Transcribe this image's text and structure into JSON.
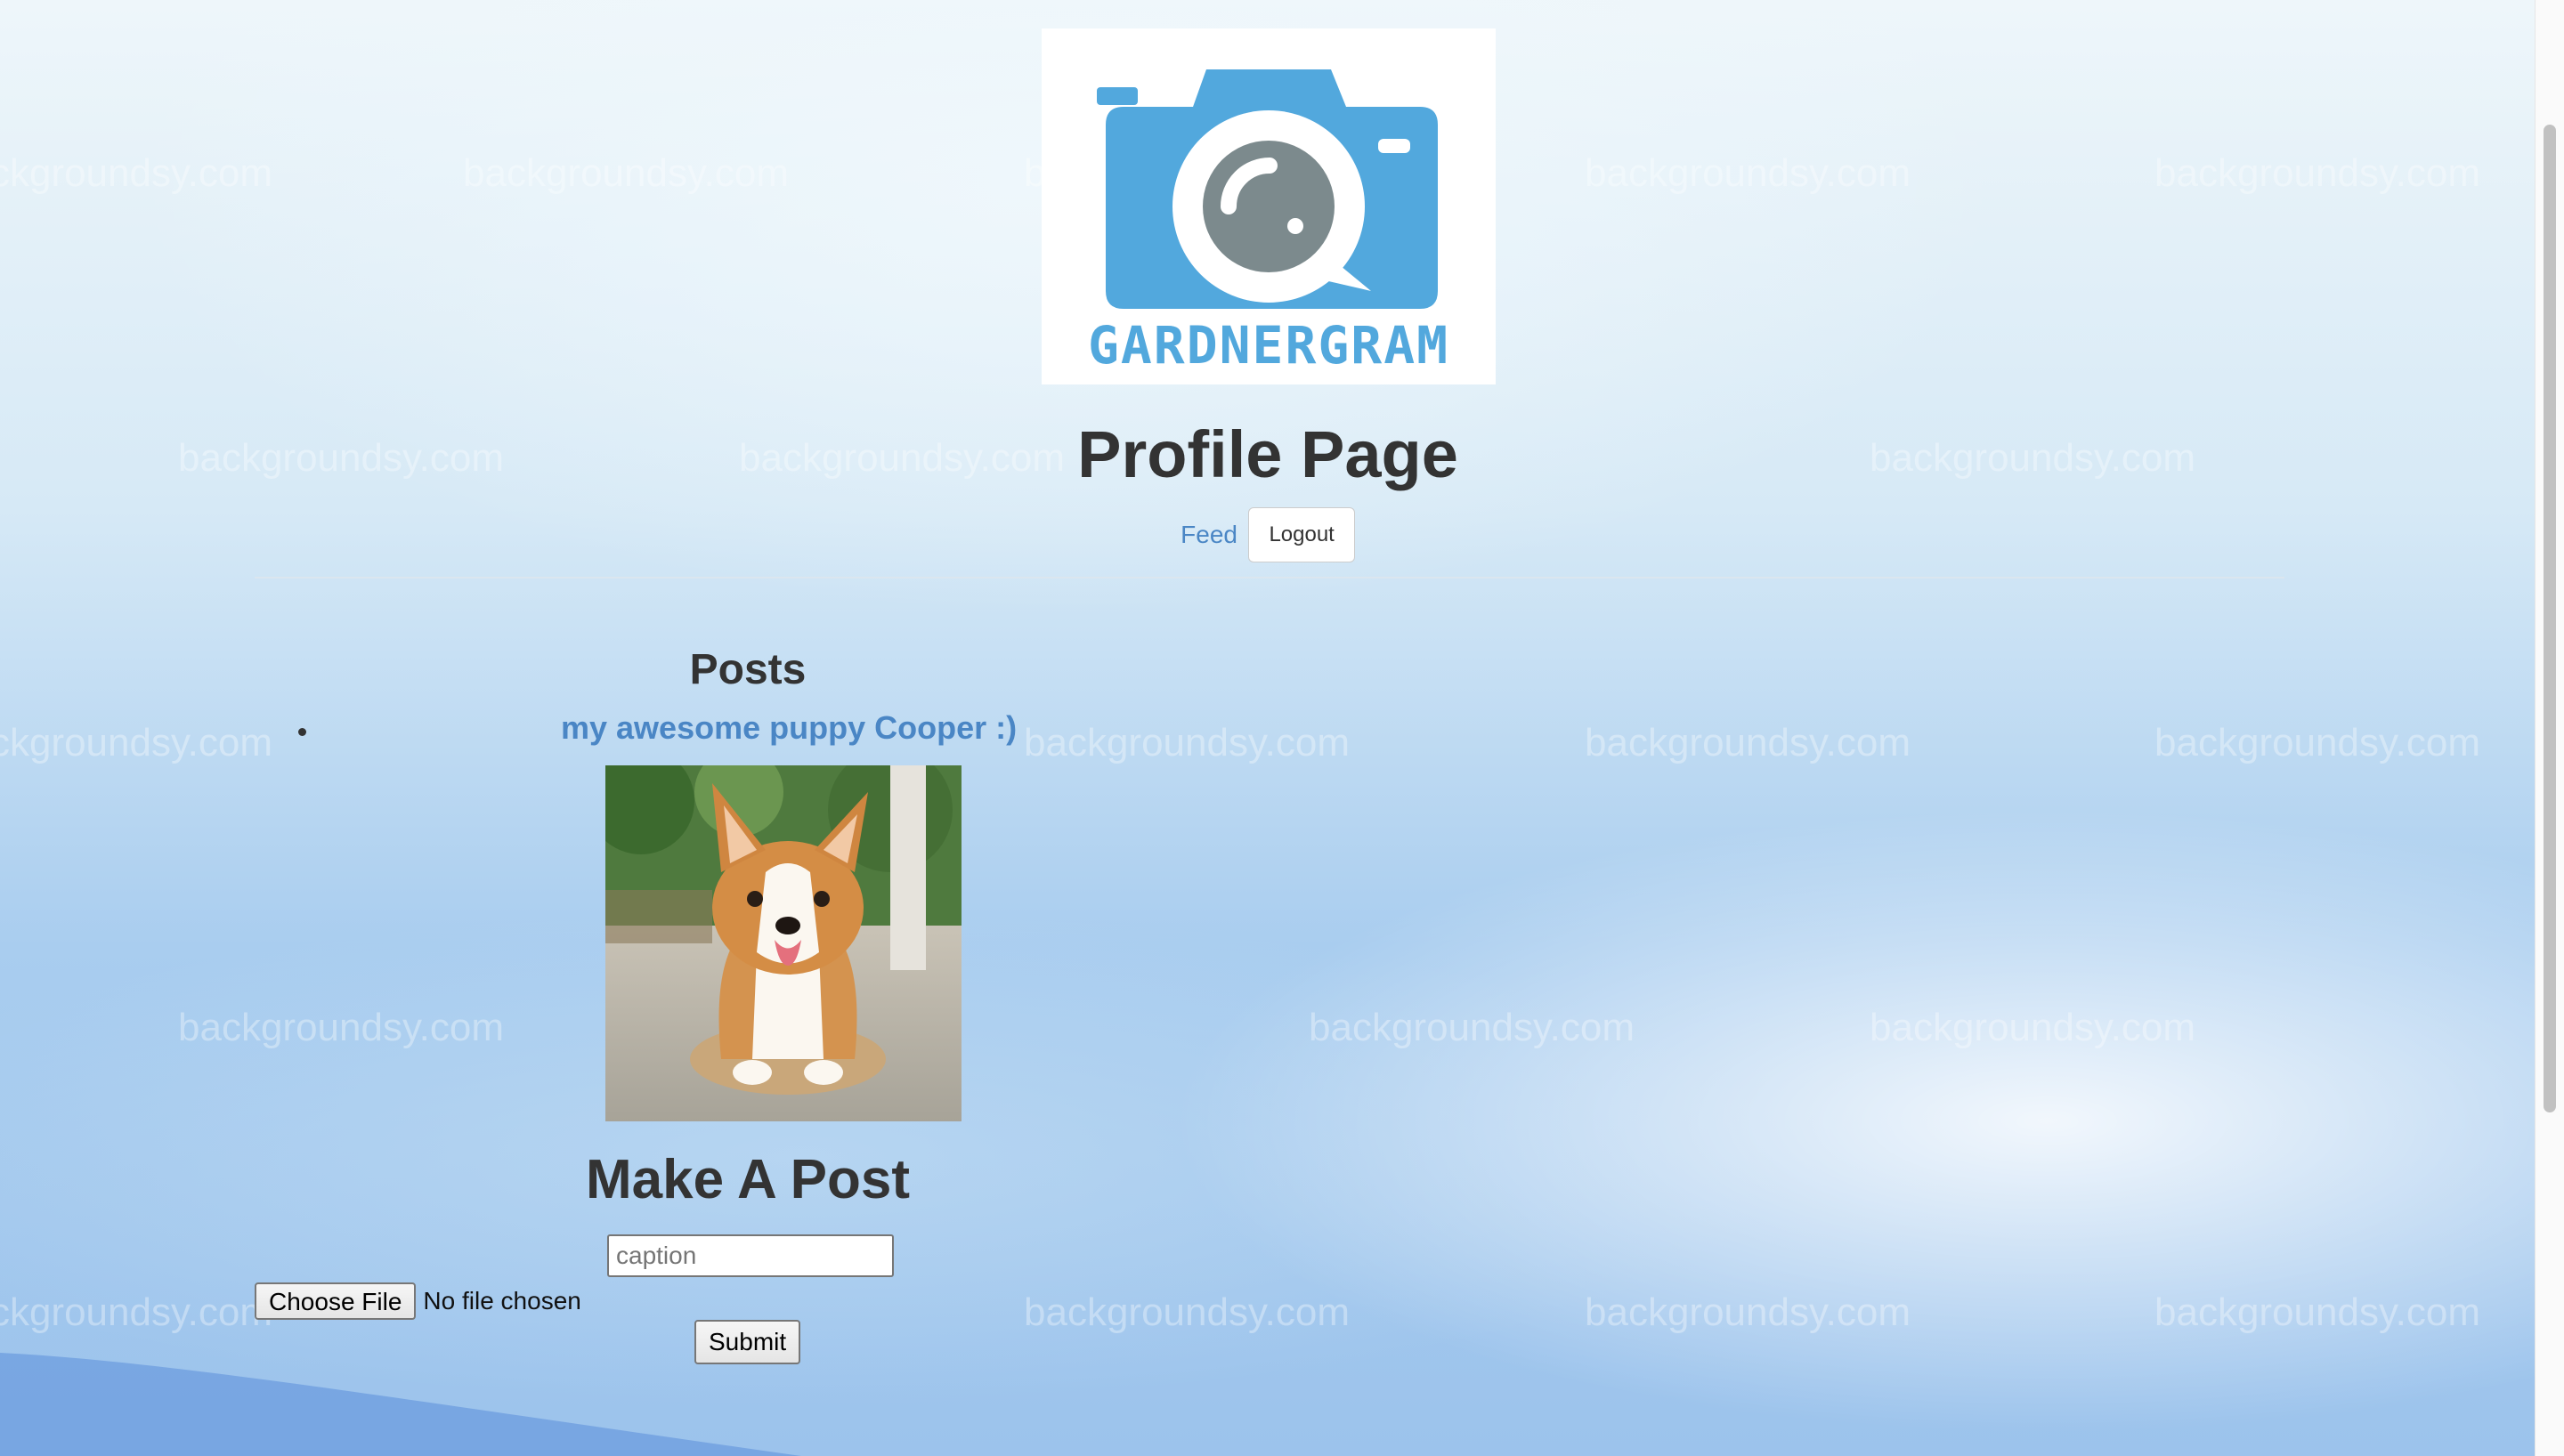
{
  "watermark": "backgroundsy.com",
  "logo": {
    "text": "GARDNERGRAM",
    "color": "#52a8dd",
    "lens_color": "#7c8a8d"
  },
  "header": {
    "title": "Profile Page"
  },
  "nav": {
    "feed_label": "Feed",
    "logout_label": "Logout"
  },
  "posts": {
    "title": "Posts",
    "items": [
      {
        "caption": "my awesome puppy Cooper :)"
      }
    ]
  },
  "make_post": {
    "title": "Make A Post",
    "caption_placeholder": "caption",
    "file_button_label": "Choose File",
    "file_status": "No file chosen",
    "submit_label": "Submit"
  }
}
